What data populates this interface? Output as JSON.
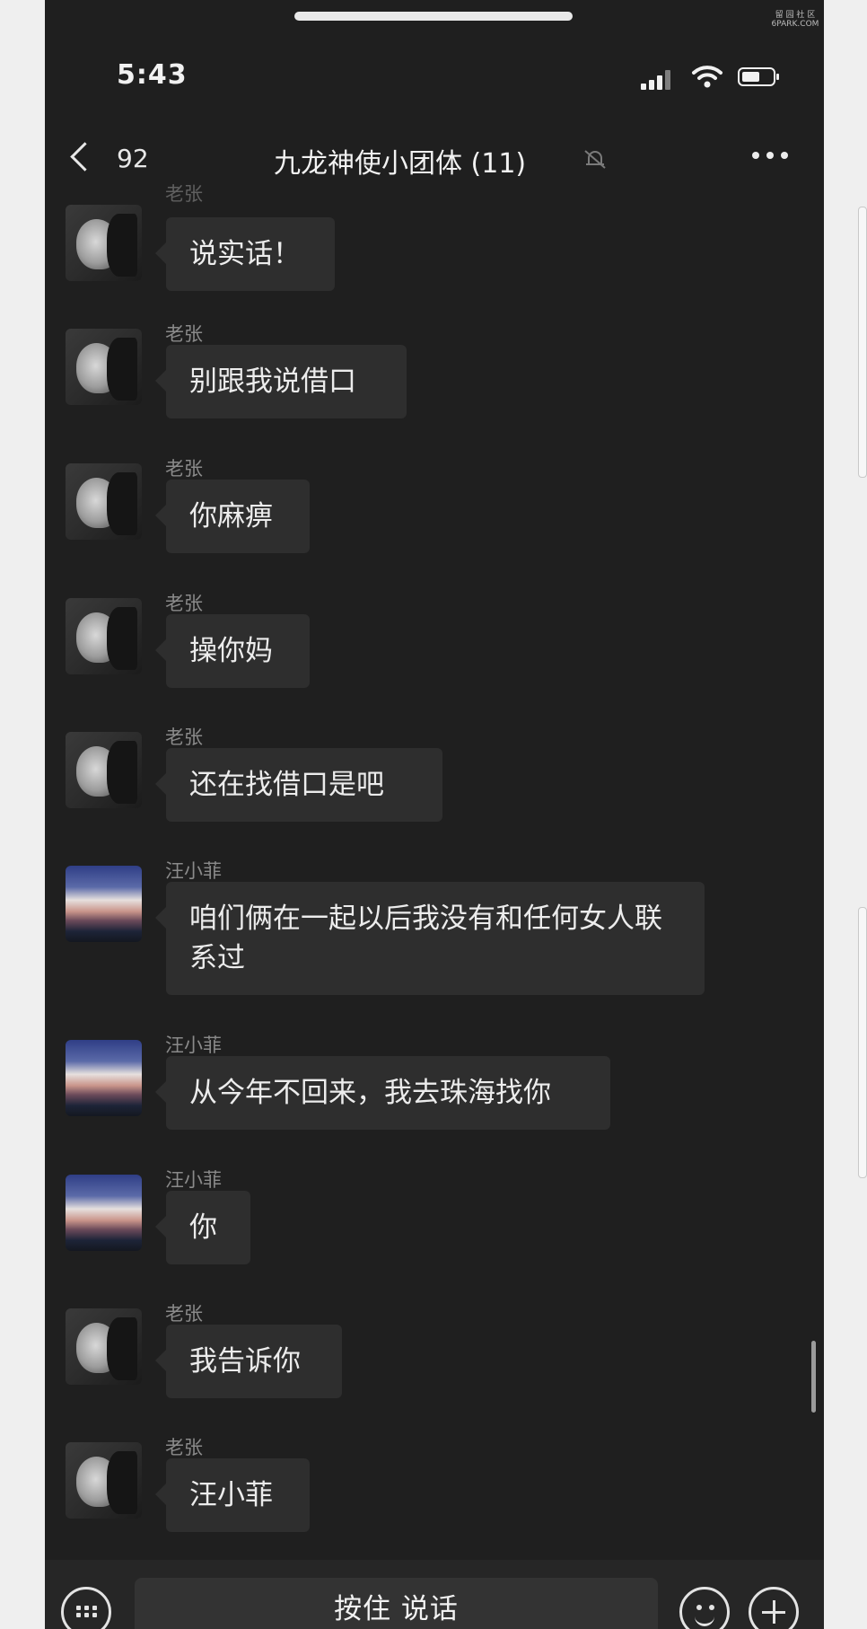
{
  "watermark": {
    "line1": "留 园 社 区",
    "line2": "6PARK.COM"
  },
  "status_bar": {
    "time": "5:43"
  },
  "header": {
    "back_count": "92",
    "title": "九龙神使小团体 (11)"
  },
  "messages": [
    {
      "sender": "老张",
      "avatar": "grey-face",
      "text": "说实话！"
    },
    {
      "sender": "老张",
      "avatar": "grey-face",
      "text": "别跟我说借口"
    },
    {
      "sender": "老张",
      "avatar": "grey-face",
      "text": "你麻痹"
    },
    {
      "sender": "老张",
      "avatar": "grey-face",
      "text": "操你妈"
    },
    {
      "sender": "老张",
      "avatar": "grey-face",
      "text": "还在找借口是吧"
    },
    {
      "sender": "汪小菲",
      "avatar": "landscape",
      "text": "咱们俩在一起以后我没有和任何女人联系过"
    },
    {
      "sender": "汪小菲",
      "avatar": "landscape",
      "text": "从今年不回来，我去珠海找你"
    },
    {
      "sender": "汪小菲",
      "avatar": "landscape",
      "text": "你"
    },
    {
      "sender": "老张",
      "avatar": "grey-face",
      "text": "我告诉你"
    },
    {
      "sender": "老张",
      "avatar": "grey-face",
      "text": "汪小菲"
    }
  ],
  "input_bar": {
    "voice_label": "按住 说话"
  }
}
